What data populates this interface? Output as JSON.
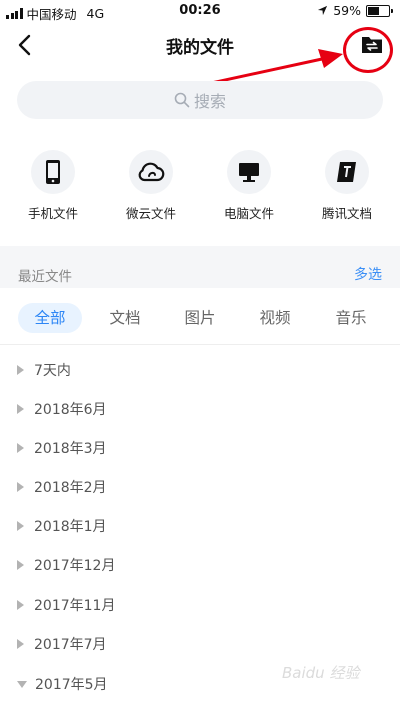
{
  "status_bar": {
    "carrier": "中国移动",
    "network": "4G",
    "time": "00:26",
    "battery": "59%",
    "battery_level": 0.59
  },
  "nav": {
    "title": "我的文件"
  },
  "search": {
    "placeholder": "搜索"
  },
  "quick_entries": [
    {
      "label": "手机文件",
      "icon": "phone-icon"
    },
    {
      "label": "微云文件",
      "icon": "cloud-icon"
    },
    {
      "label": "电脑文件",
      "icon": "monitor-icon"
    },
    {
      "label": "腾讯文档",
      "icon": "tencent-docs-icon"
    }
  ],
  "recent": {
    "title": "最近文件",
    "multi_select": "多选"
  },
  "tabs": [
    {
      "label": "全部",
      "active": true
    },
    {
      "label": "文档",
      "active": false
    },
    {
      "label": "图片",
      "active": false
    },
    {
      "label": "视频",
      "active": false
    },
    {
      "label": "音乐",
      "active": false
    }
  ],
  "groups": [
    {
      "label": "7天内",
      "expanded": false
    },
    {
      "label": "2018年6月",
      "expanded": false
    },
    {
      "label": "2018年3月",
      "expanded": false
    },
    {
      "label": "2018年2月",
      "expanded": false
    },
    {
      "label": "2018年1月",
      "expanded": false
    },
    {
      "label": "2017年12月",
      "expanded": false
    },
    {
      "label": "2017年11月",
      "expanded": false
    },
    {
      "label": "2017年7月",
      "expanded": false
    },
    {
      "label": "2017年5月",
      "expanded": true
    }
  ],
  "watermark": "Baidu 经验",
  "colors": {
    "accent": "#2d86f5",
    "annotation": "#e60012"
  }
}
